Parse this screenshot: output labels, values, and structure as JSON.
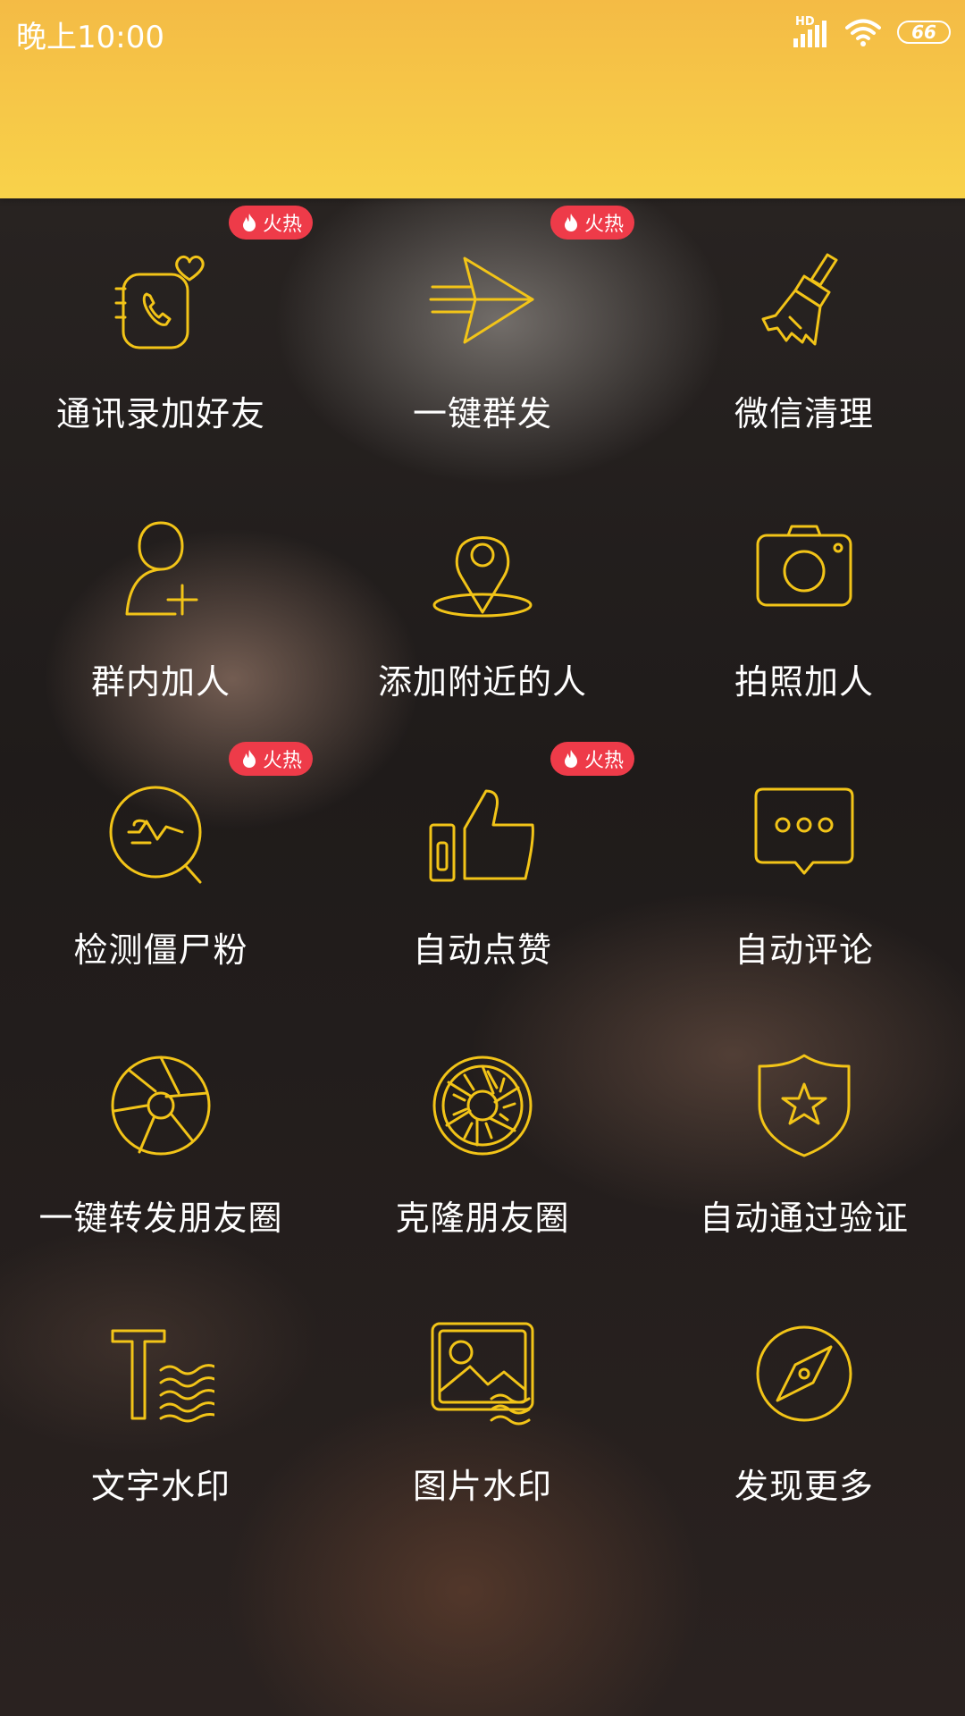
{
  "status_bar": {
    "time": "晚上10:00",
    "network": "HD",
    "battery": "66",
    "icons": [
      "signal-icon",
      "wifi-icon",
      "battery-icon"
    ]
  },
  "theme": {
    "header_gradient": [
      "#f4bb45",
      "#f8d24a"
    ],
    "icon_color": "#f2c418",
    "badge_color": "#ee3b49",
    "label_color": "#ffffff"
  },
  "badge_text": "火热",
  "features": [
    {
      "label": "通讯录加好友",
      "icon": "contacts-heart-icon",
      "hot": true
    },
    {
      "label": "一键群发",
      "icon": "paper-plane-icon",
      "hot": true
    },
    {
      "label": "微信清理",
      "icon": "broom-icon",
      "hot": false
    },
    {
      "label": "群内加人",
      "icon": "add-user-icon",
      "hot": false
    },
    {
      "label": "添加附近的人",
      "icon": "location-pin-icon",
      "hot": false
    },
    {
      "label": "拍照加人",
      "icon": "camera-icon",
      "hot": false
    },
    {
      "label": "检测僵尸粉",
      "icon": "search-wave-icon",
      "hot": true
    },
    {
      "label": "自动点赞",
      "icon": "thumbs-up-icon",
      "hot": true
    },
    {
      "label": "自动评论",
      "icon": "comment-bubble-icon",
      "hot": false
    },
    {
      "label": "一键转发朋友圈",
      "icon": "aperture-icon",
      "hot": false
    },
    {
      "label": "克隆朋友圈",
      "icon": "aperture-striped-icon",
      "hot": false
    },
    {
      "label": "自动通过验证",
      "icon": "shield-star-icon",
      "hot": false
    },
    {
      "label": "文字水印",
      "icon": "text-watermark-icon",
      "hot": false
    },
    {
      "label": "图片水印",
      "icon": "image-watermark-icon",
      "hot": false
    },
    {
      "label": "发现更多",
      "icon": "compass-icon",
      "hot": false
    }
  ]
}
